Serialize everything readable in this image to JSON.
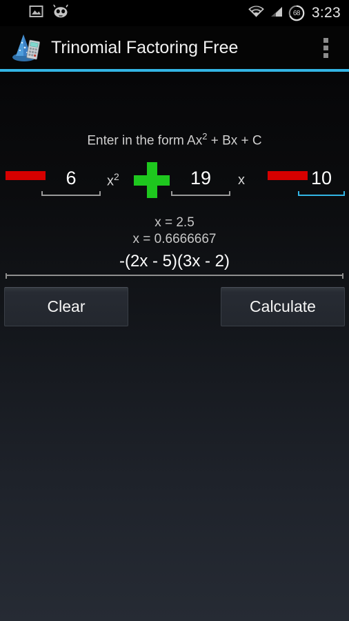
{
  "status_bar": {
    "icons": [
      "screenshot-icon",
      "cyanogenmod-icon",
      "wifi-icon",
      "signal-icon"
    ],
    "battery_level": "68",
    "clock": "3:23"
  },
  "action_bar": {
    "app_icon": "wizard-hat-calculator-icon",
    "title": "Trinomial Factoring Free",
    "overflow_menu": "overflow-menu-icon",
    "accent_color": "#33b5e5"
  },
  "main": {
    "prompt_prefix": "Enter in the form Ax",
    "prompt_exponent": "2",
    "prompt_suffix": "+ Bx + C",
    "terms": [
      {
        "sign_label": "",
        "sign_state": "minus",
        "value": "6",
        "variable": "x",
        "variable_exponent": "2",
        "focused": false
      },
      {
        "sign_label": "",
        "sign_state": "plus",
        "value": "19",
        "variable": "x",
        "variable_exponent": "",
        "focused": false
      },
      {
        "sign_label": "",
        "sign_state": "minus",
        "value": "10",
        "variable": "",
        "variable_exponent": "",
        "focused": true
      }
    ],
    "results": {
      "root_1": "x = 2.5",
      "root_2": "x = 0.6666667",
      "factored": "-(2x - 5)(3x - 2)"
    },
    "buttons": {
      "clear": "Clear",
      "calculate": "Calculate"
    }
  },
  "colors": {
    "accent": "#33b5e5",
    "minus_button": "#d60000",
    "plus_button": "#1ec71e",
    "focused_underline": "#33b5e5",
    "unfocused_underline": "#9a9a9a"
  }
}
